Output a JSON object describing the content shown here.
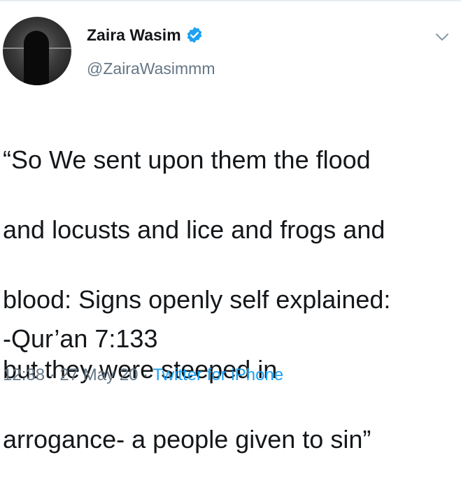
{
  "user": {
    "display_name": "Zaira Wasim",
    "handle": "@ZairaWasimmm",
    "verified": true,
    "verified_color": "#1da1f2"
  },
  "tweet": {
    "line1": "“So We sent upon them the flood",
    "line2": "and locusts and lice and frogs and",
    "line3": "blood: Signs openly self explained:",
    "line4": "but they were steeped in",
    "line5": "arrogance- a people given to sin”",
    "citation": "-Qur’an 7:133"
  },
  "meta": {
    "time": "12:38",
    "separator": " · ",
    "date": "27 May 20",
    "source": "Twitter for iPhone"
  },
  "icons": {
    "menu": "chevron-down-icon",
    "verified": "verified-badge-icon"
  }
}
